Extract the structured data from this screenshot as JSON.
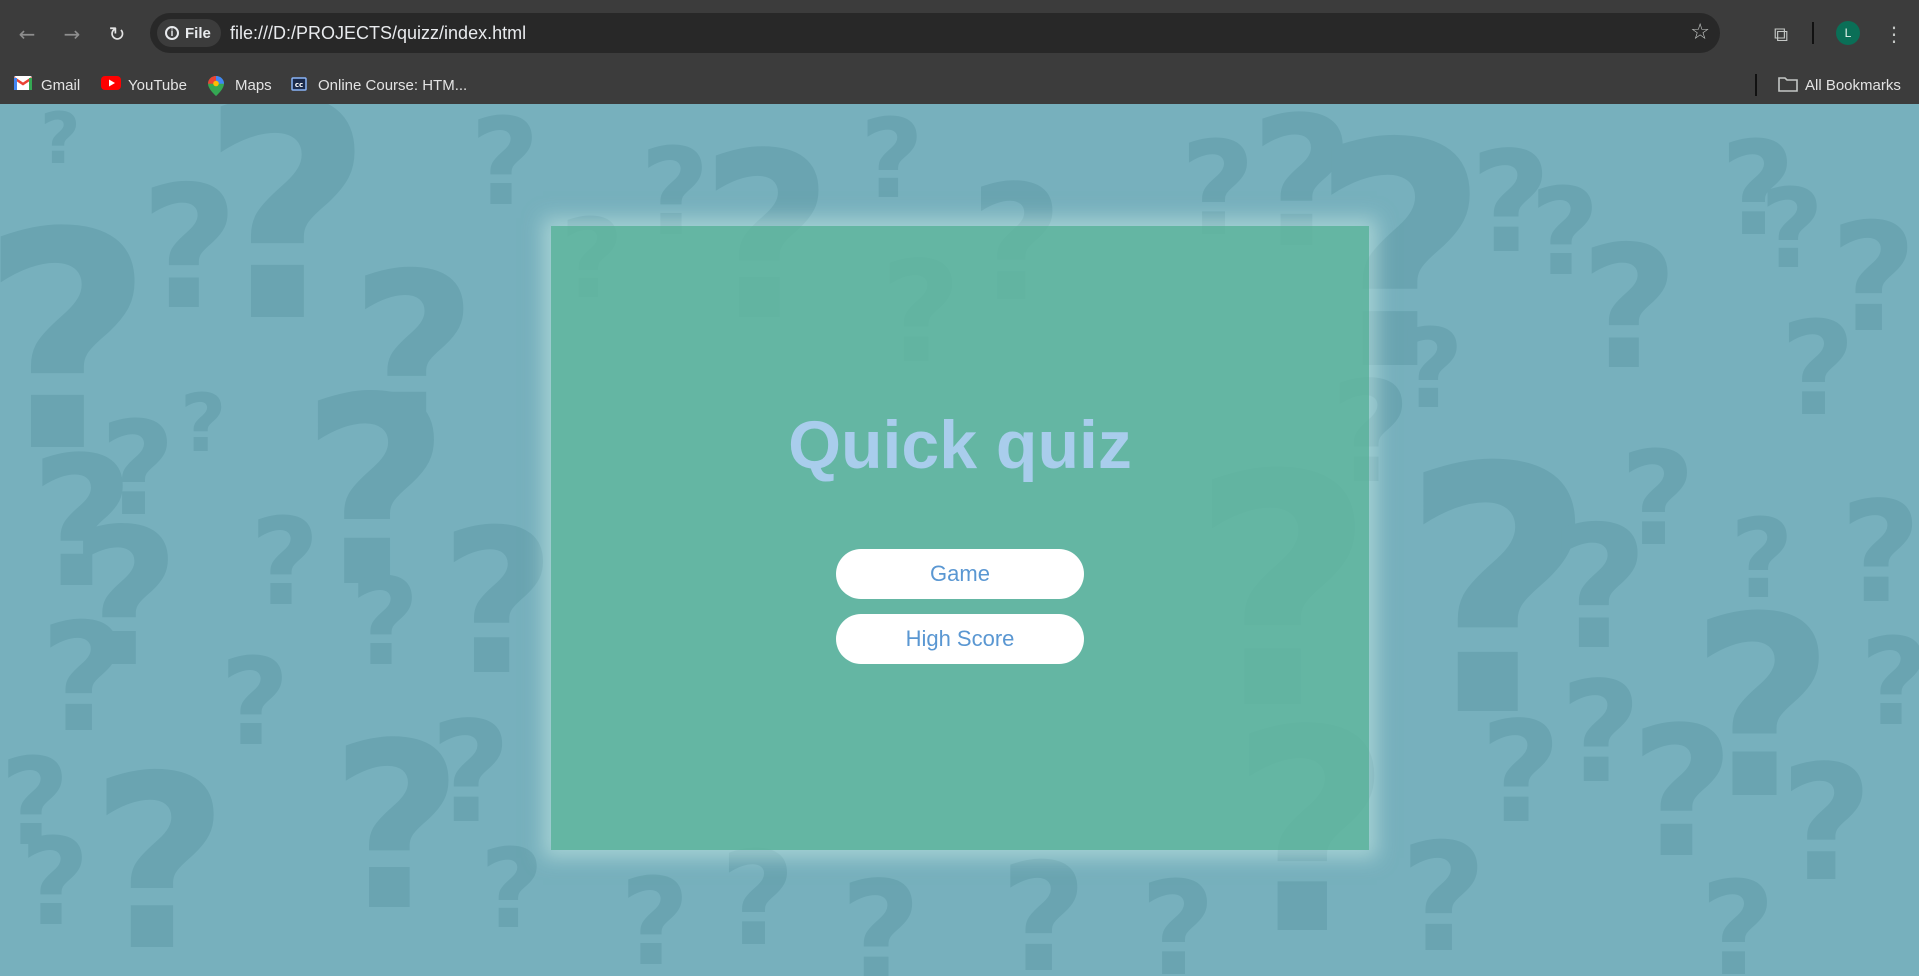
{
  "browser": {
    "site_chip": "File",
    "url": "file:///D:/PROJECTS/quizz/index.html",
    "avatar_letter": "L",
    "bookmarks": [
      {
        "label": "Gmail",
        "icon": "gmail-icon"
      },
      {
        "label": "YouTube",
        "icon": "youtube-icon"
      },
      {
        "label": "Maps",
        "icon": "maps-icon"
      },
      {
        "label": "Online Course: HTM...",
        "icon": "course-icon"
      }
    ],
    "all_bookmarks": "All Bookmarks",
    "colors": {
      "frame": "#3c3c3c",
      "omnibox": "#282828"
    }
  },
  "quiz": {
    "title": "Quick quiz",
    "buttons": {
      "game": "Game",
      "high_score": "High Score"
    },
    "colors": {
      "background": "#77b0bd",
      "card": "#60b79e",
      "title": "#a9cdec",
      "button_text": "#5a97d2"
    }
  }
}
